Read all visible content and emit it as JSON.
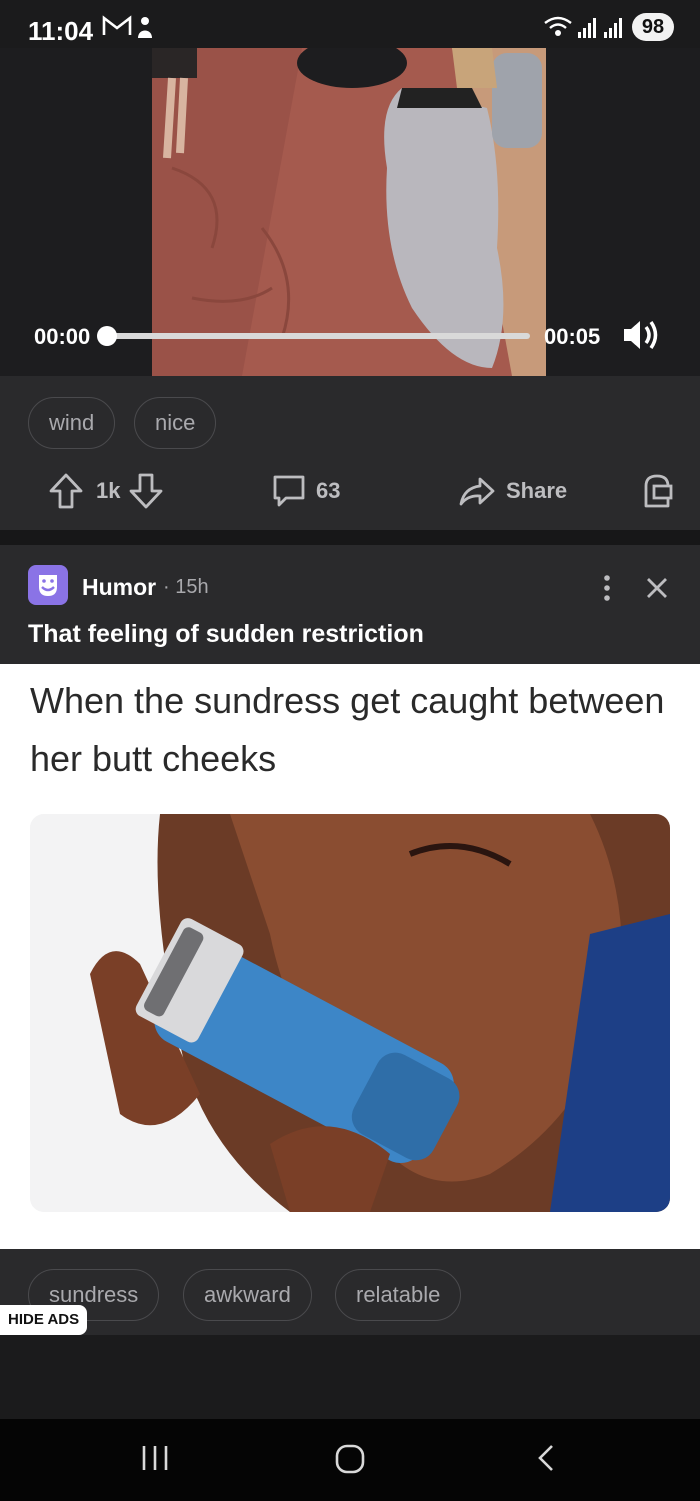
{
  "status_bar": {
    "time": "11:04",
    "battery": "98"
  },
  "video": {
    "current_time": "00:00",
    "duration": "00:05",
    "progress": 0.0
  },
  "post1": {
    "tags": [
      "wind",
      "nice"
    ],
    "upvotes": "1k",
    "comments": "63",
    "share_label": "Share"
  },
  "post2": {
    "group": "Humor",
    "separator": "·",
    "time": "15h",
    "title": "That feeling of sudden restriction",
    "meme_caption": "When the sundress get caught between her butt cheeks",
    "tags": [
      "sundress",
      "awkward",
      "relatable"
    ]
  },
  "ads": {
    "hide_label": "HIDE ADS"
  },
  "colors": {
    "accent_avatar": "#8a73e6",
    "card_bg": "#2a2a2c",
    "page_bg": "#1b1b1c"
  },
  "icons": [
    "gmail-icon",
    "notification-icon",
    "wifi-icon",
    "signal-icon",
    "volume-icon",
    "upvote-icon",
    "downvote-icon",
    "comment-icon",
    "share-icon",
    "award-icon",
    "more-options-icon",
    "close-icon",
    "recents-icon",
    "home-icon",
    "back-icon"
  ]
}
